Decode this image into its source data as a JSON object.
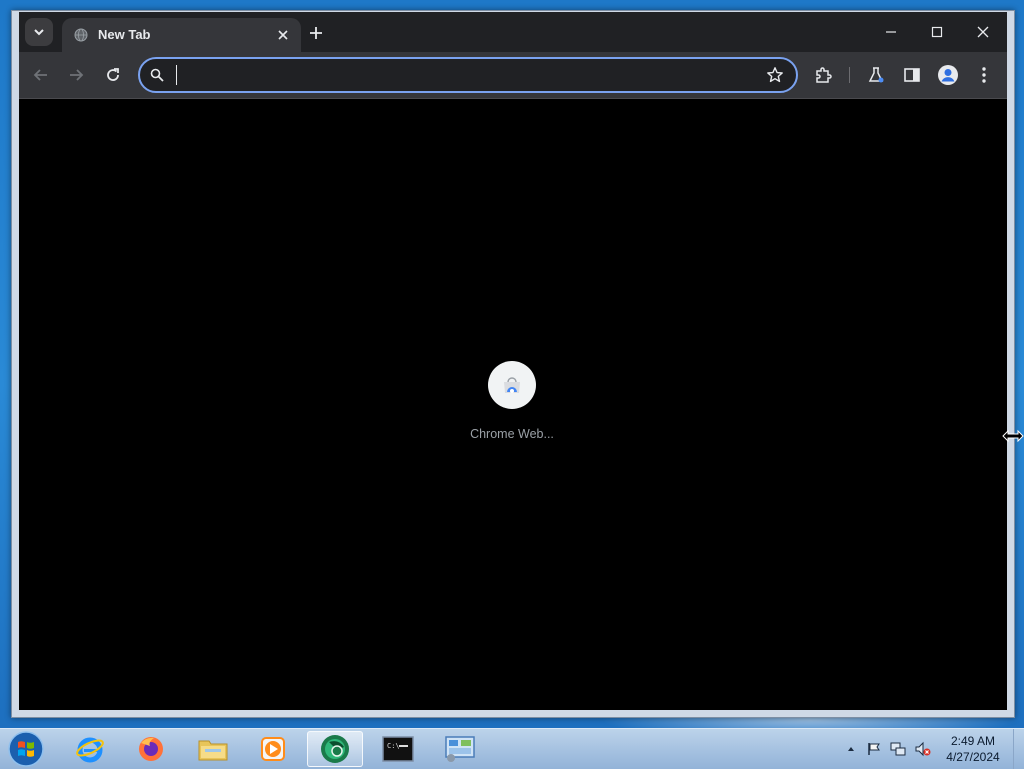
{
  "browser": {
    "tab": {
      "title": "New Tab",
      "icon": "globe-icon"
    },
    "toolbar": {
      "address_value": "",
      "back_icon": "back-arrow-icon",
      "forward_icon": "forward-arrow-icon",
      "reload_icon": "reload-icon",
      "bookmark_icon": "star-icon",
      "extensions_icon": "puzzle-icon",
      "labs_icon": "flask-icon",
      "side_panel_icon": "side-panel-icon",
      "profile_icon": "avatar-icon",
      "menu_icon": "kebab-menu-icon"
    },
    "window_controls": [
      "minimize",
      "maximize",
      "close"
    ],
    "accent_color": "#7aa2f0"
  },
  "new_tab_page": {
    "shortcuts": [
      {
        "label": "Chrome Web...",
        "icon": "chrome-web-store-icon"
      }
    ]
  },
  "taskbar": {
    "apps": [
      {
        "name": "Internet Explorer",
        "icon": "ie-icon"
      },
      {
        "name": "Firefox",
        "icon": "firefox-icon"
      },
      {
        "name": "File Explorer",
        "icon": "folder-icon"
      },
      {
        "name": "Media Player",
        "icon": "media-player-icon"
      },
      {
        "name": "Chrome",
        "icon": "chrome-icon",
        "active": true
      },
      {
        "name": "Command Prompt",
        "icon": "cmd-icon"
      },
      {
        "name": "Control Panel",
        "icon": "control-panel-icon"
      }
    ],
    "tray": {
      "time": "2:49 AM",
      "date": "4/27/2024",
      "icons": [
        "show-hidden-icon",
        "flag-icon",
        "network-icon",
        "volume-muted-icon"
      ]
    }
  }
}
